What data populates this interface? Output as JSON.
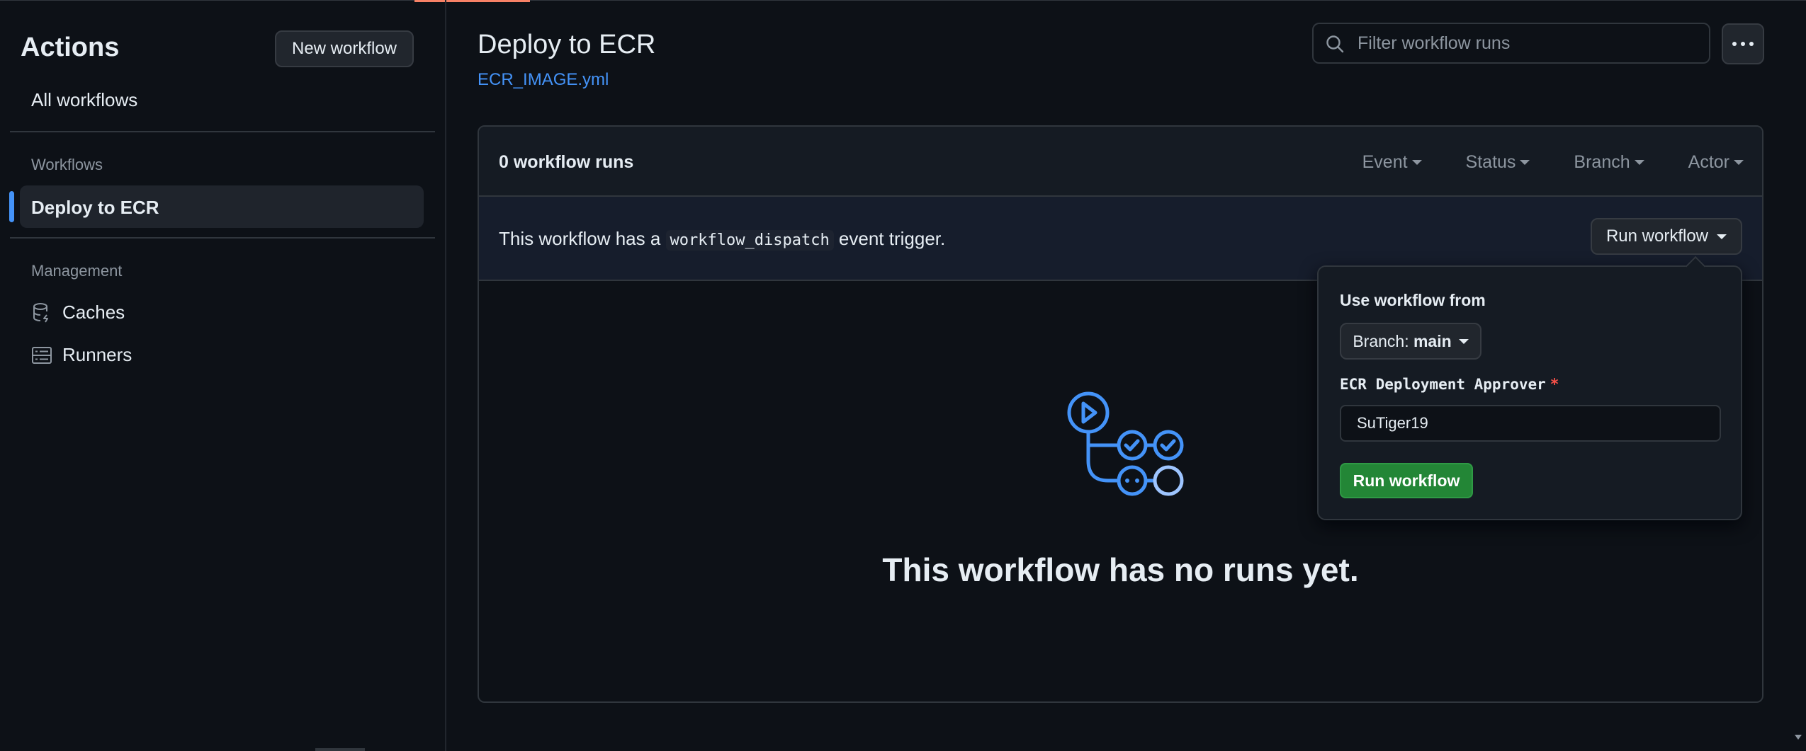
{
  "sidebar": {
    "title": "Actions",
    "new_workflow_label": "New workflow",
    "all_workflows_label": "All workflows",
    "workflows_section": "Workflows",
    "active_workflow": "Deploy to ECR",
    "management_section": "Management",
    "items": [
      {
        "label": "Caches",
        "icon": "database-icon"
      },
      {
        "label": "Runners",
        "icon": "server-icon"
      }
    ]
  },
  "header": {
    "title": "Deploy to ECR",
    "file_link": "ECR_IMAGE.yml",
    "filter_placeholder": "Filter workflow runs",
    "more_icon": "kebab-horizontal-icon"
  },
  "runs": {
    "count_label": "0 workflow runs",
    "filters": [
      "Event",
      "Status",
      "Branch",
      "Actor"
    ]
  },
  "trigger": {
    "text_before": "This workflow has a ",
    "code": "workflow_dispatch",
    "text_after": " event trigger.",
    "run_button": "Run workflow"
  },
  "popover": {
    "heading": "Use workflow from",
    "branch_prefix": "Branch: ",
    "branch_value": "main",
    "field_label": "ECR Deployment Approver",
    "required_mark": "*",
    "field_value": "SuTiger19",
    "submit_label": "Run workflow"
  },
  "empty_state": {
    "message": "This workflow has no runs yet.",
    "icon": "workflow-graph-icon"
  },
  "colors": {
    "background": "#0d1117",
    "accent": "#4493f8",
    "success": "#238636",
    "danger": "#f85149"
  }
}
